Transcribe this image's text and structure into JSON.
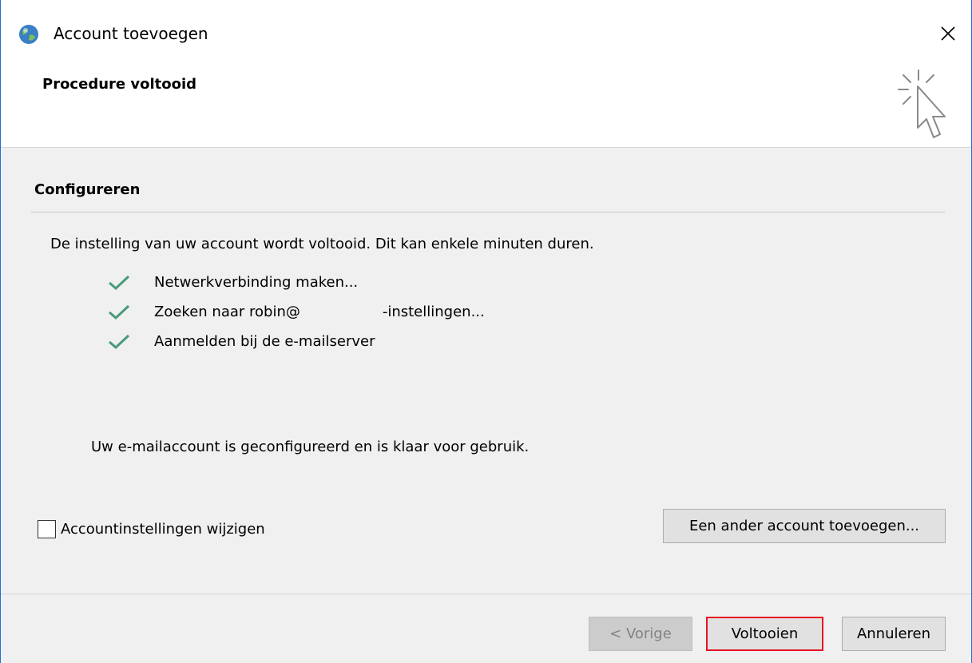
{
  "window": {
    "title": "Account toevoegen",
    "close_symbol": "✕"
  },
  "header": {
    "title": "Procedure voltooid",
    "icon": "cursor-click-icon"
  },
  "content": {
    "section_title": "Configureren",
    "intro": "De instelling van uw account wordt voltooid. Dit kan enkele minuten duren.",
    "steps": [
      {
        "label": "Netwerkverbinding maken...",
        "status": "done"
      },
      {
        "label": "Zoeken naar robin@                  -instellingen...",
        "status": "done"
      },
      {
        "label": "Aanmelden bij de e-mailserver",
        "status": "done"
      }
    ],
    "ready_message": "Uw e-mailaccount is geconfigureerd en is klaar voor gebruik.",
    "change_settings_label": "Accountinstellingen wijzigen",
    "change_settings_checked": false,
    "add_other_account_label": "Een ander account toevoegen..."
  },
  "footer": {
    "back_label": "< Vorige",
    "finish_label": "Voltooien",
    "cancel_label": "Annuleren"
  },
  "colors": {
    "check": "#4a9a7a",
    "highlight": "#e81123",
    "window_border": "#1f6fd1"
  }
}
